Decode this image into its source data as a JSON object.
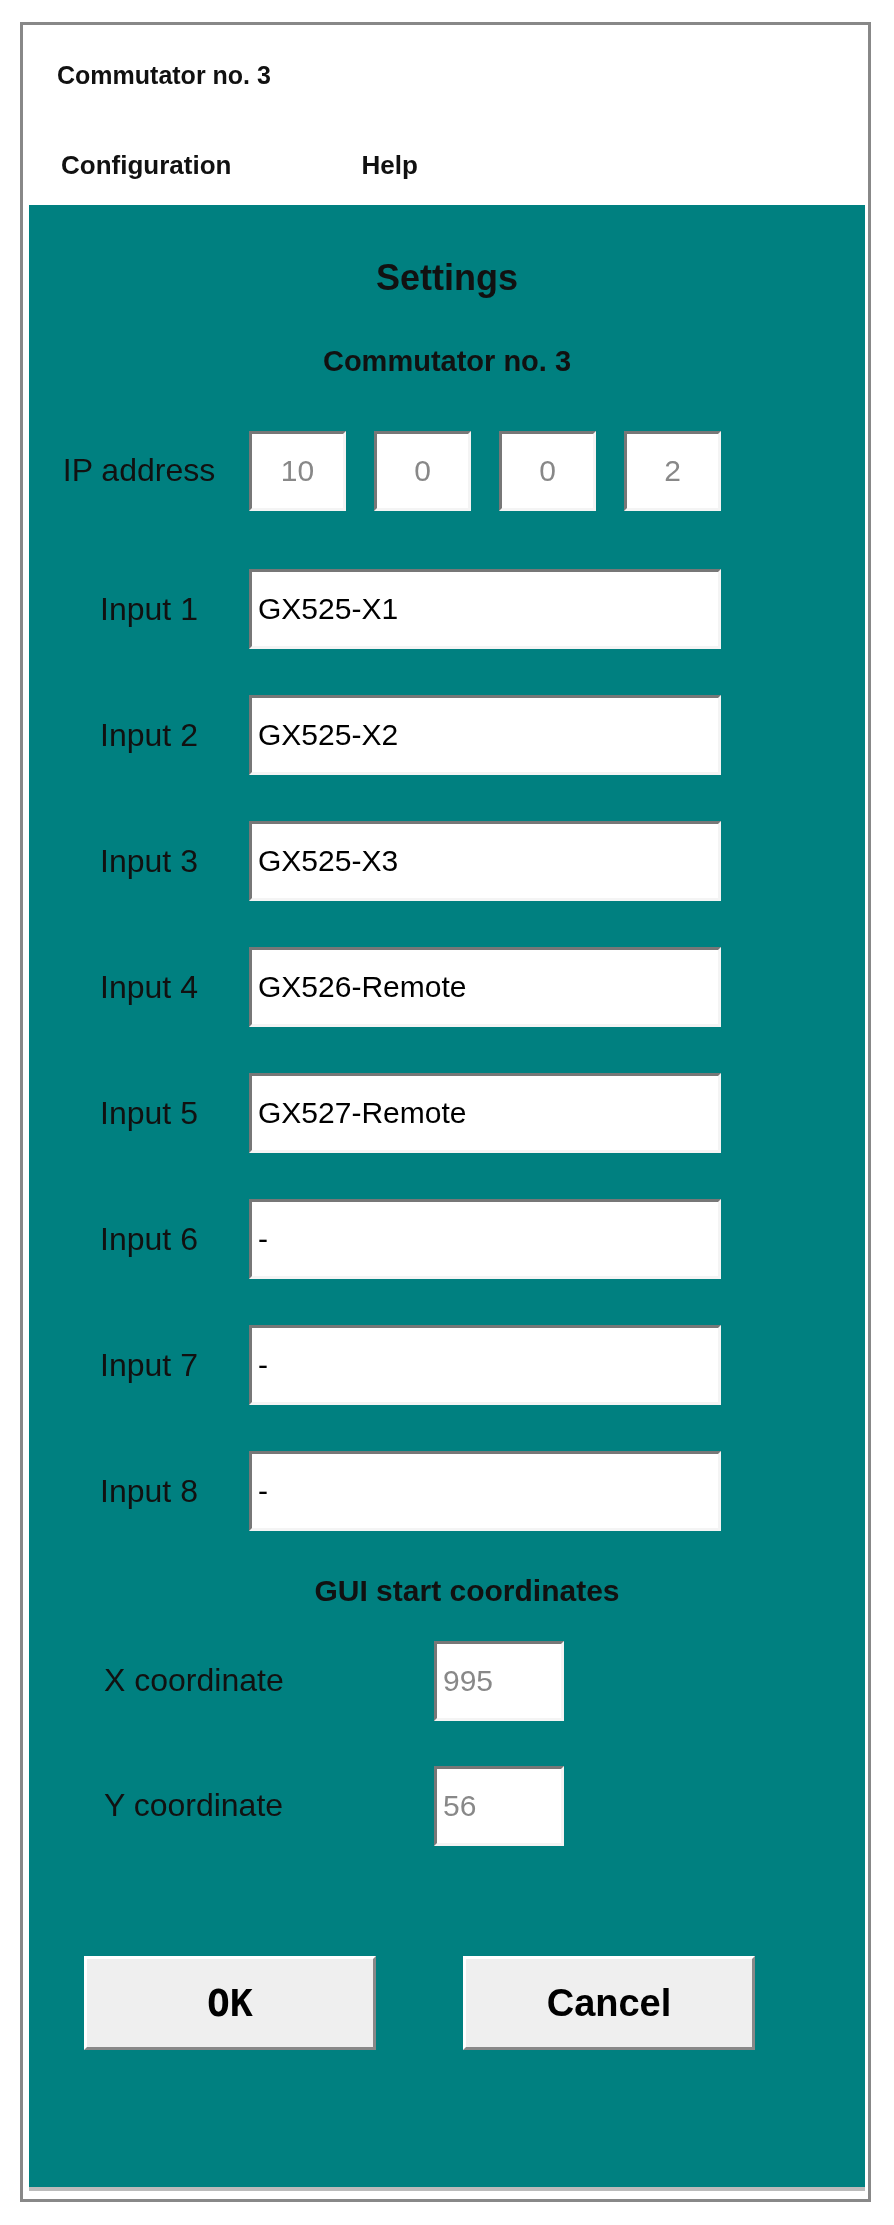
{
  "window": {
    "title": "Commutator no. 3"
  },
  "menu": [
    "Configuration",
    "Help"
  ],
  "heading": "Settings",
  "subheading": "Commutator no. 3",
  "ip": {
    "label": "IP address",
    "octets": [
      {
        "value": "10",
        "disabled": true
      },
      {
        "value": "0",
        "disabled": true
      },
      {
        "value": "0",
        "disabled": true
      },
      {
        "value": "2",
        "disabled": true
      }
    ]
  },
  "inputs": [
    {
      "label": "Input 1",
      "value": "GX525-X1",
      "disabled": false
    },
    {
      "label": "Input 2",
      "value": "GX525-X2",
      "disabled": false
    },
    {
      "label": "Input 3",
      "value": "GX525-X3",
      "disabled": false
    },
    {
      "label": "Input 4",
      "value": "GX526-Remote",
      "disabled": false
    },
    {
      "label": "Input 5",
      "value": "GX527-Remote",
      "disabled": false
    },
    {
      "label": "Input 6",
      "value": "-",
      "disabled": false
    },
    {
      "label": "Input 7",
      "value": "-",
      "disabled": false
    },
    {
      "label": "Input 8",
      "value": "-",
      "disabled": false
    }
  ],
  "coordinates": {
    "title": "GUI start coordinates",
    "fields": [
      {
        "label": "X coordinate",
        "value": "995",
        "disabled": true
      },
      {
        "label": "Y coordinate",
        "value": "56",
        "disabled": true
      }
    ]
  },
  "buttons": [
    "OK",
    "Cancel"
  ]
}
